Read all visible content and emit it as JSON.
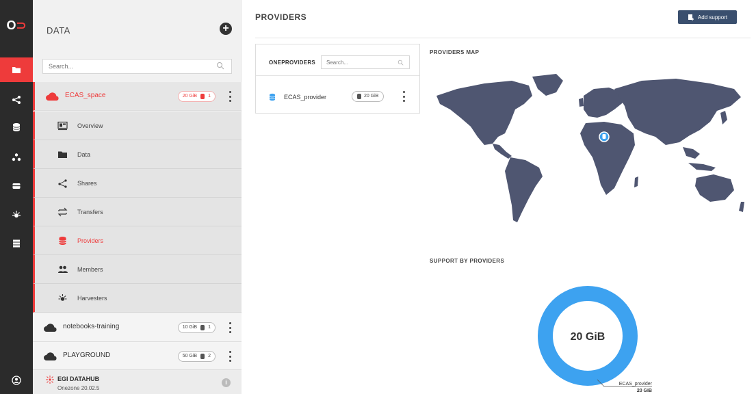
{
  "app": {
    "logo_text": "O",
    "logo_accent": "⊃"
  },
  "colors": {
    "accent": "#ee3b3b",
    "iconbar": "#2b2b2b",
    "donut": "#3da2f0",
    "map": "#4f5671",
    "button": "#3a4f6e"
  },
  "iconbar": {
    "items": [
      {
        "icon": "folder-icon"
      },
      {
        "icon": "share-icon"
      },
      {
        "icon": "database-icon"
      },
      {
        "icon": "groups-icon"
      },
      {
        "icon": "tokens-icon"
      },
      {
        "icon": "harvester-icon"
      },
      {
        "icon": "clusters-icon"
      },
      {
        "icon": "user-icon"
      }
    ]
  },
  "sidebar": {
    "title": "DATA",
    "search_placeholder": "Search...",
    "spaces": [
      {
        "name": "ECAS_space",
        "size": "20 GiB",
        "providers": "1"
      },
      {
        "name": "notebooks-training",
        "size": "10 GiB",
        "providers": "1"
      },
      {
        "name": "PLAYGROUND",
        "size": "50 GiB",
        "providers": "2"
      }
    ],
    "submenu": [
      {
        "label": "Overview",
        "icon": "overview-icon"
      },
      {
        "label": "Data",
        "icon": "folder-icon"
      },
      {
        "label": "Shares",
        "icon": "share-icon"
      },
      {
        "label": "Transfers",
        "icon": "transfers-icon"
      },
      {
        "label": "Providers",
        "icon": "database-icon"
      },
      {
        "label": "Members",
        "icon": "members-icon"
      },
      {
        "label": "Harvesters",
        "icon": "harvester-icon"
      }
    ],
    "footer": {
      "title": "EGI DATAHUB",
      "version": "Onezone 20.02.5",
      "info": "i"
    }
  },
  "main": {
    "title": "PROVIDERS",
    "add_support": "Add support",
    "providers_card": {
      "title": "ONEPROVIDERS",
      "search_placeholder": "Search...",
      "rows": [
        {
          "name": "ECAS_provider",
          "size": "20 GiB"
        }
      ]
    },
    "map_title": "PROVIDERS MAP",
    "support_title": "SUPPORT BY PROVIDERS"
  },
  "chart_data": {
    "type": "pie",
    "title": "SUPPORT BY PROVIDERS",
    "center_label": "20 GiB",
    "categories": [
      "ECAS_provider"
    ],
    "values": [
      20
    ],
    "labels": [
      "20 GiB"
    ]
  }
}
